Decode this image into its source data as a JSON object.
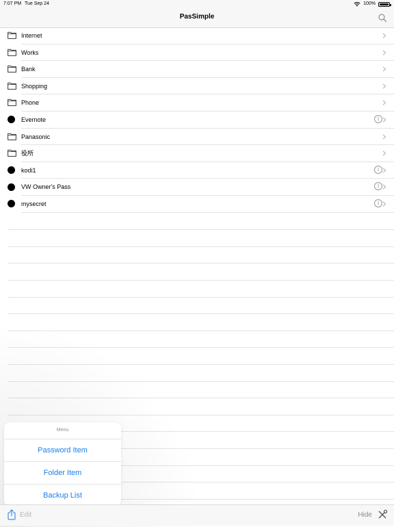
{
  "status_bar": {
    "time": "7:07 PM",
    "date": "Tue Sep 24",
    "battery": "100%"
  },
  "nav": {
    "title": "PasSimple"
  },
  "list": {
    "items": [
      {
        "label": "Internet",
        "kind": "folder",
        "info": false
      },
      {
        "label": "Works",
        "kind": "folder",
        "info": false
      },
      {
        "label": "Bank",
        "kind": "folder",
        "info": false
      },
      {
        "label": "Shopping",
        "kind": "folder",
        "info": false
      },
      {
        "label": "Phone",
        "kind": "folder",
        "info": false
      },
      {
        "label": "Evernote",
        "kind": "password",
        "info": true
      },
      {
        "label": "Panasonic",
        "kind": "folder",
        "info": false
      },
      {
        "label": "役所",
        "kind": "folder",
        "info": false
      },
      {
        "label": "kodi1",
        "kind": "password",
        "info": true
      },
      {
        "label": "VW Owner's Pass",
        "kind": "password",
        "info": true
      },
      {
        "label": "mysecret",
        "kind": "password",
        "info": true
      }
    ]
  },
  "menu": {
    "header": "Menu",
    "items": [
      "Password Item",
      "Folder Item",
      "Backup List"
    ]
  },
  "toolbar": {
    "edit_label": "Edit",
    "hide_label": "Hide"
  },
  "colors": {
    "accent": "#1a7ee6",
    "bar_background": "#f7f7f7",
    "separator": "#e3e3e3"
  },
  "icons": {
    "search": "search-icon",
    "folder": "folder-icon",
    "password": "password-dot-icon",
    "info": "info-icon",
    "chevron": "chevron-right-icon",
    "share": "share-icon",
    "tools": "tools-icon"
  }
}
